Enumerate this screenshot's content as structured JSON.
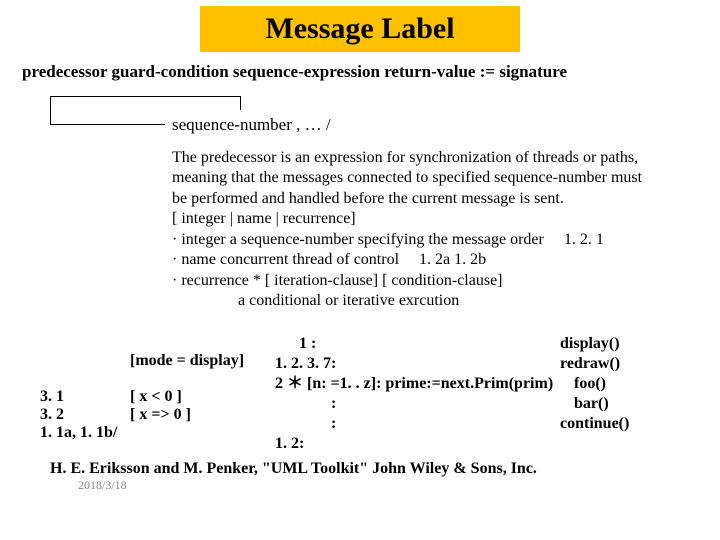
{
  "title": "Message Label",
  "syntax": "predecessor guard-condition sequence-expression return-value := signature",
  "seqnum": "sequence-number , … /",
  "para_l1": "The predecessor is an expression for synchronization of threads or paths,",
  "para_l2": "meaning that the messages connected to specified sequence-number must",
  "para_l3": "be performed and handled before the current message is sent.",
  "para_l4": "[ integer | name | recurrence]",
  "para_l5a": "· integer  a sequence-number specifying the message order",
  "para_l5b": "1. 2. 1",
  "para_l6a": "· name  concurrent thread of control",
  "para_l6b": "1. 2a  1. 2b",
  "para_l7": "· recurrence  * [ iteration-clause] [ condition-clause]",
  "para_l8": "a conditional or iterative exrcution",
  "mode": "[mode = display]",
  "exL1a": "3. 1",
  "exL1b": "[ x < 0 ]",
  "exL2a": "3. 2",
  "exL2b": "[ x => 0 ]",
  "exL3a": "1. 1a, 1. 1b/",
  "mid1": "1 :",
  "mid2": "1. 2. 3. 7:",
  "mid3": "2 ＊ [n: =1. . z]:  prime:=next.Prim(prim)",
  "mid4": ":",
  "mid5": ":",
  "mid6": "1. 2:",
  "r1": "display()",
  "r2": "redraw()",
  "r3": "",
  "r4": "foo()",
  "r5": "bar()",
  "r6": "continue()",
  "citation": "H. E. Eriksson and M. Penker, \"UML Toolkit\" John Wiley & Sons, Inc.",
  "date": "2018/3/18"
}
